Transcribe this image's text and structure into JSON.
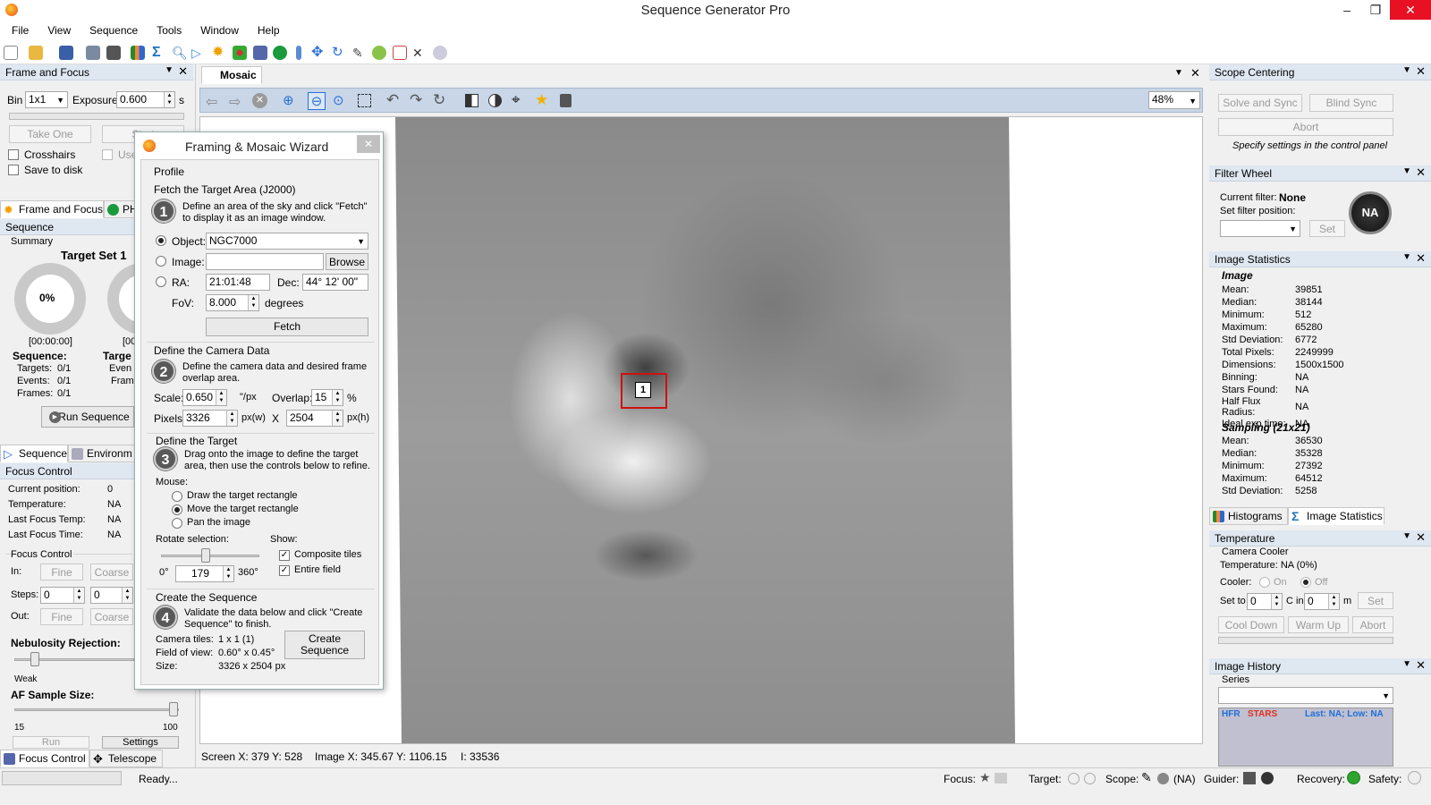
{
  "window": {
    "title": "Sequence Generator Pro",
    "min": "–",
    "max": "❐",
    "close": "✕"
  },
  "menu": [
    "File",
    "View",
    "Sequence",
    "Tools",
    "Window",
    "Help"
  ],
  "toolbar_icons": [
    "new-icon",
    "open-icon",
    "save-icon",
    "camera-settings-icon",
    "camera-icon",
    "histogram-icon",
    "sigma-icon",
    "search-icon",
    "play-icon",
    "sun-icon",
    "cluster-icon",
    "rocket-icon",
    "globe-icon",
    "thermometer-icon",
    "move-icon",
    "rotate-icon",
    "pencil-icon",
    "crosshair-globe-icon",
    "checklist-icon",
    "satellite-icon",
    "cloud-icon"
  ],
  "frame_focus": {
    "title": "Frame and Focus",
    "bin_label": "Bin",
    "bin_value": "1x1",
    "exposure_label": "Exposure:",
    "exposure_value": "0.600",
    "exposure_unit": "s",
    "take_one": "Take One",
    "start": "Start",
    "crosshairs": "Crosshairs",
    "save_to_disk": "Save to disk",
    "use": "Use"
  },
  "left_tabs": {
    "frame_focus": "Frame and Focus",
    "phd": "PH"
  },
  "sequence": {
    "title": "Sequence",
    "summary": "Summary",
    "target_set": "Target Set 1",
    "progress": "0%",
    "progress_value": 0,
    "time": "[00:00:00]",
    "time2": "[00",
    "seq_label": "Sequence:",
    "targets": "Targets:",
    "targets_v": "0/1",
    "events": "Events:",
    "events_v": "0/1",
    "frames": "Frames:",
    "frames_v": "0/1",
    "target_label": "Targe",
    "even": "Even",
    "frame": "Frame",
    "run": "Run Sequence"
  },
  "seq_tabs": {
    "sequence": "Sequence",
    "environment": "Environm"
  },
  "focus": {
    "title": "Focus Control",
    "current_position": "Current position:",
    "current_position_v": "0",
    "temperature": "Temperature:",
    "temperature_v": "NA",
    "last_temp": "Last Focus Temp:",
    "last_temp_v": "NA",
    "last_time": "Last Focus Time:",
    "last_time_v": "NA",
    "group": "Focus Control",
    "in": "In:",
    "fine": "Fine",
    "coarse": "Coarse",
    "steps": "Steps:",
    "steps1": "0",
    "steps2": "0",
    "out": "Out:",
    "nebulosity": "Nebulosity Rejection:",
    "weak": "Weak",
    "af_sample": "AF Sample Size:",
    "af_min": "15",
    "af_max": "100",
    "run": "Run",
    "settings": "Settings"
  },
  "bottom_tabs": {
    "focus": "Focus Control",
    "telescope": "Telescope"
  },
  "doc_tab": "Mosaic",
  "zoom": "48%",
  "status": {
    "screen": "Screen X: 379 Y: 528",
    "image": "Image X: 345.67 Y: 1106.15",
    "intensity": "I: 33536",
    "ready": "Ready...",
    "focus": "Focus:",
    "target": "Target:",
    "scope": "Scope:",
    "scope_v": "(NA)",
    "guider": "Guider:",
    "recovery": "Recovery:",
    "safety": "Safety:"
  },
  "tile_label": "1",
  "wizard": {
    "title": "Framing & Mosaic Wizard",
    "profile": "Profile",
    "fetch_section": "Fetch the Target Area (J2000)",
    "step1": "1",
    "step1_text": "Define an area of the sky and click \"Fetch\" to display it as an image window.",
    "object_label": "Object:",
    "object_value": "NGC7000",
    "image_label": "Image:",
    "browse": "Browse",
    "ra_label": "RA:",
    "ra_value": "21:01:48",
    "dec_label": "Dec:",
    "dec_value": "44° 12' 00\"",
    "fov_label": "FoV:",
    "fov_value": "8.000",
    "fov_unit": "degrees",
    "fetch": "Fetch",
    "camera_section": "Define the Camera Data",
    "step2": "2",
    "step2_text": "Define the camera data and desired frame overlap area.",
    "scale_label": "Scale:",
    "scale_value": "0.650",
    "scale_unit": "\"/px",
    "overlap_label": "Overlap:",
    "overlap_value": "15",
    "overlap_unit": "%",
    "pixels_label": "Pixels:",
    "px_w": "3326",
    "px_w_unit": "px(w)",
    "x": "X",
    "px_h": "2504",
    "px_h_unit": "px(h)",
    "target_section": "Define the Target",
    "step3": "3",
    "step3_text": "Drag onto the image to define the target area, then use the controls below to refine.",
    "mouse_label": "Mouse:",
    "mouse_draw": "Draw the target rectangle",
    "mouse_move": "Move the target rectangle",
    "mouse_pan": "Pan the image",
    "rotate_label": "Rotate selection:",
    "rot_min": "0°",
    "rot_value": "179",
    "rot_max": "360°",
    "show_label": "Show:",
    "composite": "Composite tiles",
    "entire": "Entire field",
    "create_section": "Create the Sequence",
    "step4": "4",
    "step4_text": "Validate the data below and click \"Create Sequence\" to finish.",
    "camera_tiles": "Camera tiles:",
    "camera_tiles_v": "1 x 1 (1)",
    "fov_label2": "Field of view:",
    "fov_v": "0.60° x 0.45°",
    "size_label": "Size:",
    "size_v": "3326 x 2504 px",
    "create": "Create Sequence"
  },
  "scope_centering": {
    "title": "Scope Centering",
    "solve_sync": "Solve and Sync",
    "blind_sync": "Blind Sync",
    "abort": "Abort",
    "note": "Specify settings in the control panel"
  },
  "filter_wheel": {
    "title": "Filter Wheel",
    "current_label": "Current filter:",
    "current_value": "None",
    "set_position": "Set filter position:",
    "set": "Set",
    "badge": "NA"
  },
  "image_stats": {
    "title": "Image Statistics",
    "image_head": "Image",
    "image_rows": [
      [
        "Mean:",
        "39851"
      ],
      [
        "Median:",
        "38144"
      ],
      [
        "Minimum:",
        "512"
      ],
      [
        "Maximum:",
        "65280"
      ],
      [
        "Std Deviation:",
        "6772"
      ],
      [
        "Total Pixels:",
        "2249999"
      ],
      [
        "Dimensions:",
        "1500x1500"
      ],
      [
        "Binning:",
        "NA"
      ],
      [
        "Stars Found:",
        "NA"
      ],
      [
        "Half Flux Radius:",
        "NA"
      ],
      [
        "Ideal exp time:",
        "NA"
      ]
    ],
    "sampling_head": "Sampling (21x21)",
    "sampling_rows": [
      [
        "Mean:",
        "36530"
      ],
      [
        "Median:",
        "35328"
      ],
      [
        "Minimum:",
        "27392"
      ],
      [
        "Maximum:",
        "64512"
      ],
      [
        "Std Deviation:",
        "5258"
      ]
    ]
  },
  "right_tabs": {
    "histograms": "Histograms",
    "image_statistics": "Image Statistics"
  },
  "temperature": {
    "title": "Temperature",
    "camera_cooler": "Camera Cooler",
    "temp": "Temperature: NA (0%)",
    "cooler": "Cooler:",
    "on": "On",
    "off": "Off",
    "set_to": "Set to",
    "set_value": "0",
    "c_in": "C in",
    "in_value": "0",
    "m": "m",
    "set": "Set",
    "cool_down": "Cool Down",
    "warm_up": "Warm Up",
    "abort": "Abort"
  },
  "image_history": {
    "title": "Image History",
    "series": "Series",
    "hfr": "HFR",
    "stars": "STARS",
    "last": "Last: NA; Low: NA"
  },
  "colors": {
    "panel_header": "#dfe7f1",
    "accent": "#1e73be",
    "hfr": "#1e6ed8",
    "stars": "#e0301e"
  }
}
